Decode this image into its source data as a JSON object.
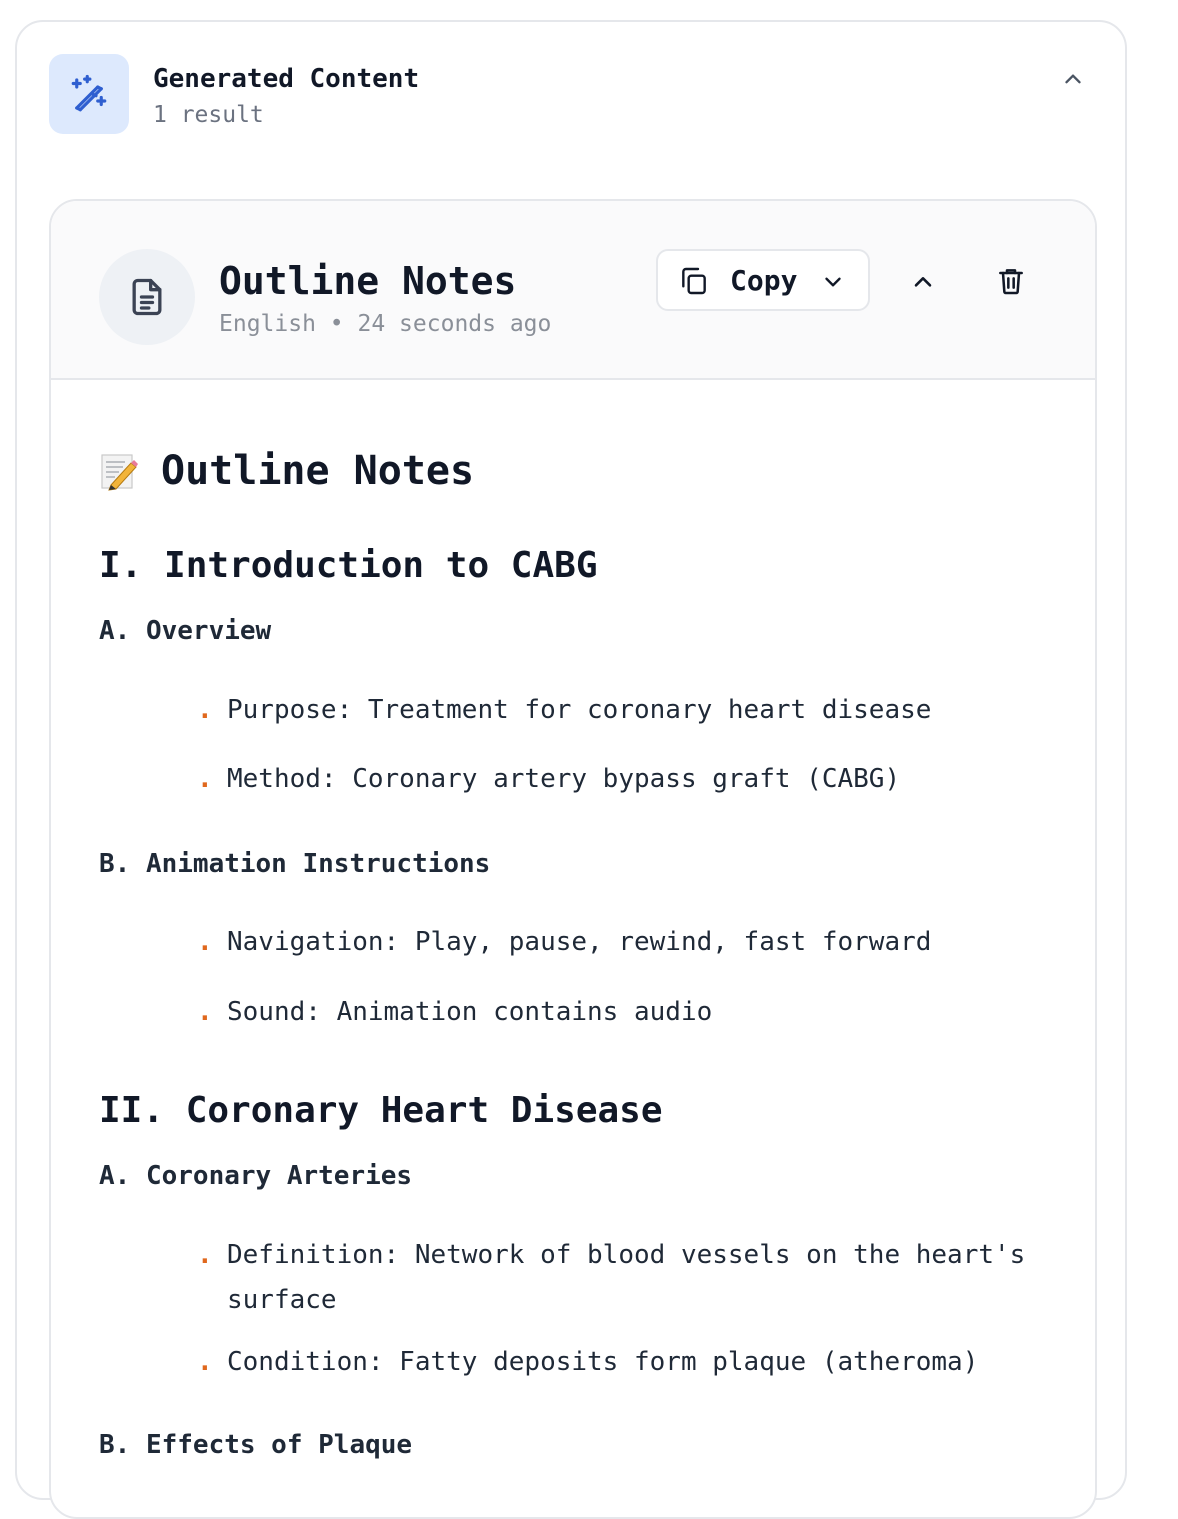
{
  "panel": {
    "title": "Generated Content",
    "subtitle": "1 result"
  },
  "result": {
    "title": "Outline Notes",
    "language": "English",
    "separator": "•",
    "time": "24 seconds ago",
    "copy_label": "Copy"
  },
  "document": {
    "heading": "Outline Notes",
    "sections": [
      {
        "title": "I. Introduction to CABG",
        "subsections": [
          {
            "title": "A. Overview",
            "bullets": [
              "Purpose: Treatment for coronary heart disease",
              "Method: Coronary artery bypass graft (CABG)"
            ]
          },
          {
            "title": "B. Animation Instructions",
            "bullets": [
              "Navigation: Play, pause, rewind, fast forward",
              "Sound: Animation contains audio"
            ]
          }
        ]
      },
      {
        "title": "II. Coronary Heart Disease",
        "subsections": [
          {
            "title": "A. Coronary Arteries",
            "bullets": [
              "Definition: Network of blood vessels on the heart's surface",
              "Condition: Fatty deposits form plaque (atheroma)"
            ]
          },
          {
            "title": "B. Effects of Plaque",
            "bullets": []
          }
        ]
      }
    ]
  },
  "icons": {
    "panel": "magic-wand-icon",
    "result": "document-icon",
    "copy": "copy-icon",
    "dropdown": "chevron-down-icon",
    "collapse": "chevron-up-icon",
    "delete": "trash-icon",
    "heading": "memo-icon"
  },
  "colors": {
    "accent": "#2f5fd0",
    "bullet": "#e0681d",
    "tile": "#dde9fd"
  }
}
